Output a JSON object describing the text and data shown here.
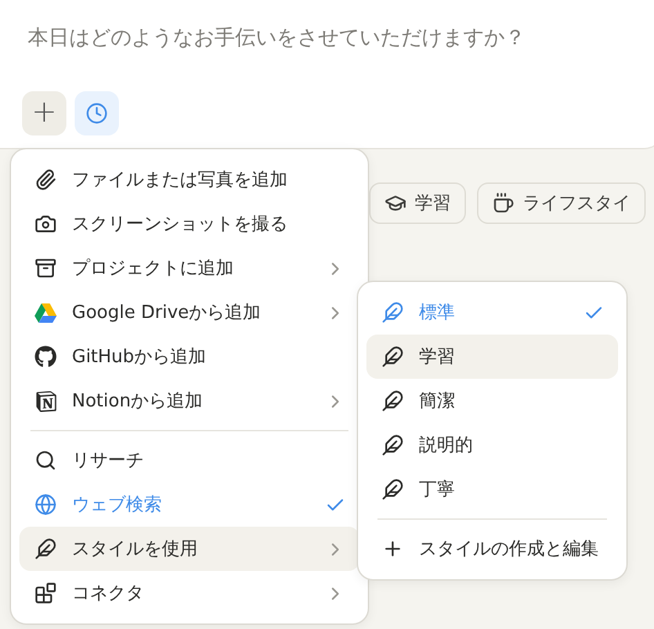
{
  "composer": {
    "placeholder": "本日はどのようなお手伝いをさせていただけますか？",
    "plus_button": {
      "label": "+"
    },
    "history_button": {
      "active": true
    }
  },
  "chips": [
    {
      "label": "学習"
    },
    {
      "label": "ライフスタイ"
    }
  ],
  "menu": {
    "groups": [
      [
        {
          "label": "ファイルまたは写真を追加",
          "submenu": false,
          "checked": false,
          "selected": false
        },
        {
          "label": "スクリーンショットを撮る",
          "submenu": false,
          "checked": false,
          "selected": false
        },
        {
          "label": "プロジェクトに追加",
          "submenu": true,
          "checked": false,
          "selected": false
        },
        {
          "label": "Google Driveから追加",
          "submenu": true,
          "checked": false,
          "selected": false
        },
        {
          "label": "GitHubから追加",
          "submenu": false,
          "checked": false,
          "selected": false
        },
        {
          "label": "Notionから追加",
          "submenu": true,
          "checked": false,
          "selected": false
        }
      ],
      [
        {
          "label": "リサーチ",
          "submenu": false,
          "checked": false,
          "selected": false
        },
        {
          "label": "ウェブ検索",
          "submenu": false,
          "checked": true,
          "selected": false
        },
        {
          "label": "スタイルを使用",
          "submenu": true,
          "checked": false,
          "selected": true
        },
        {
          "label": "コネクタ",
          "submenu": true,
          "checked": false,
          "selected": false
        }
      ]
    ]
  },
  "style_menu": {
    "items": [
      {
        "label": "標準",
        "checked": true,
        "selected": false
      },
      {
        "label": "学習",
        "checked": false,
        "selected": true
      },
      {
        "label": "簡潔",
        "checked": false,
        "selected": false
      },
      {
        "label": "説明的",
        "checked": false,
        "selected": false
      },
      {
        "label": "丁寧",
        "checked": false,
        "selected": false
      }
    ],
    "action": {
      "label": "スタイルの作成と編集"
    }
  }
}
